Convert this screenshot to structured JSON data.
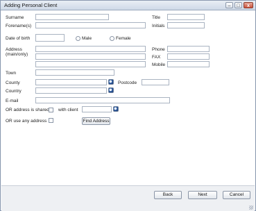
{
  "window": {
    "title": "Adding Personal Client",
    "minimize_glyph": "–",
    "maximize_glyph": "□",
    "close_glyph": "x"
  },
  "form": {
    "surname_label": "Surname",
    "forenames_label": "Forename(s)",
    "dob_label": "Date of birth",
    "male_label": "Male",
    "female_label": "Female",
    "title_label": "Title",
    "initials_label": "Initials",
    "address_label_1": "Address",
    "address_label_2": "(main/only)",
    "phone_label": "Phone",
    "fax_label": "FAX",
    "mobile_label": "Mobile",
    "town_label": "Town",
    "county_label": "County",
    "postcode_label": "Postcode",
    "country_label": "Country",
    "email_label": "E-mail",
    "shared_label": "OR address is shared",
    "with_client_label": "with client",
    "any_address_label": "OR use any address",
    "find_address_label": "Find Address"
  },
  "footer": {
    "back_label": "Back",
    "next_label": "Next",
    "cancel_label": "Cancel"
  }
}
